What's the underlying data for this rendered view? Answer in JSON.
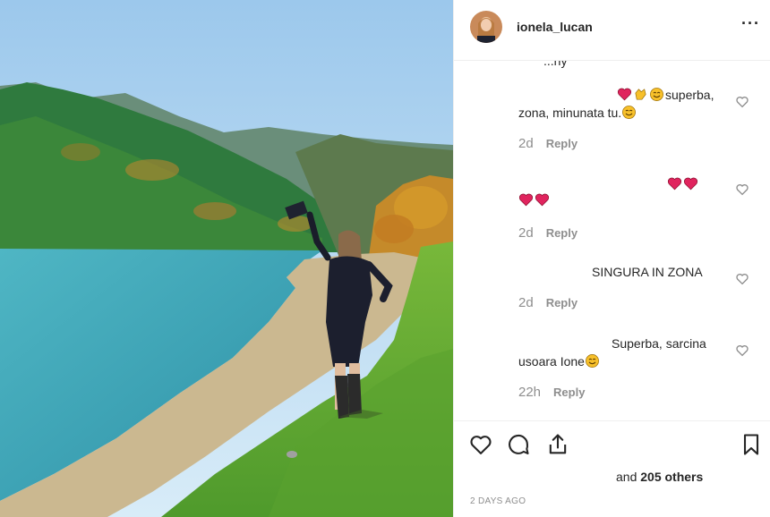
{
  "post": {
    "username": "ionela_lucan",
    "more_label": "···",
    "partial_comment": "...ny"
  },
  "comments": [
    {
      "line1": "superba,",
      "line2": "zona, minunata tu.",
      "time": "2d",
      "reply": "Reply"
    },
    {
      "line1": "",
      "line2": "",
      "time": "2d",
      "reply": "Reply"
    },
    {
      "line1": "SINGURA IN ZONA",
      "time": "2d",
      "reply": "Reply"
    },
    {
      "line1": "Superba, sarcina",
      "line2": "usoara Ione",
      "time": "22h",
      "reply": "Reply"
    }
  ],
  "actions": {
    "likes_prefix": "and ",
    "likes_count": "205 others",
    "date": "2 DAYS AGO"
  },
  "icons": {
    "like": "heart-outline-icon",
    "comment": "comment-bubble-icon",
    "share": "share-icon",
    "save": "bookmark-icon",
    "more": "more-dots-icon"
  },
  "colors": {
    "emoji_heart": "#e0245e",
    "emoji_face": "#f7c02a",
    "text": "#262626",
    "muted": "#8e8e8e"
  }
}
